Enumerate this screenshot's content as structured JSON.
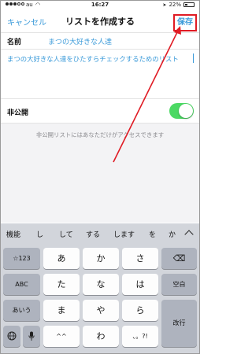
{
  "status": {
    "carrier": "au",
    "time": "16:27",
    "battery": "22%"
  },
  "nav": {
    "cancel": "キャンセル",
    "title": "リストを作成する",
    "save": "保存"
  },
  "form": {
    "name_label": "名前",
    "name_value": "まつの大好きな人達",
    "description_value": "まつの大好きな人達をひたすらチェックするためのリスト",
    "private_label": "非公開",
    "private_on": true,
    "private_note": "非公開リストにはあなただけがアクセスできます"
  },
  "predictive": [
    "機能",
    "し",
    "して",
    "する",
    "します",
    "を",
    "か"
  ],
  "keyboard": {
    "row1": {
      "left": "☆123",
      "keys": [
        "あ",
        "か",
        "さ"
      ],
      "right": "⌫"
    },
    "row2": {
      "left": "ABC",
      "keys": [
        "た",
        "な",
        "は"
      ],
      "right": "空白"
    },
    "row3": {
      "left": "あいう",
      "keys": [
        "ま",
        "や",
        "ら"
      ],
      "right": "改行"
    },
    "row4": {
      "left_icon": "globe-icon",
      "mic_icon": "mic-icon",
      "keys": [
        "^^",
        "わ",
        "、。?!"
      ]
    }
  },
  "colors": {
    "accent": "#3a9ad9",
    "highlight_red": "#e01b24",
    "toggle_on": "#4cd964"
  }
}
